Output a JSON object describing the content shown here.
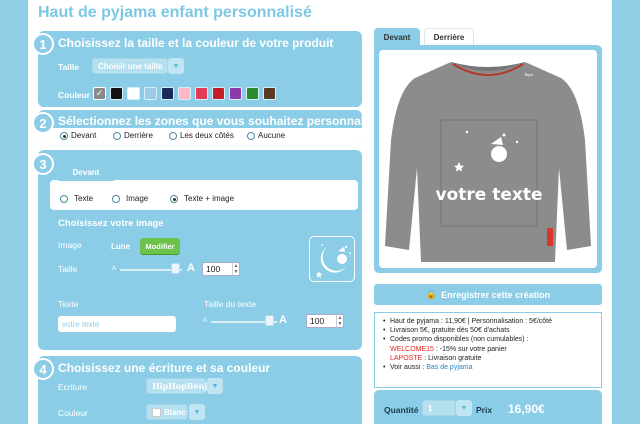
{
  "page": {
    "title": "Haut de pyjama enfant personnalisé"
  },
  "step1": {
    "number": "1",
    "title": "Choisissez la taille et la couleur de votre produit",
    "size_label": "Taille",
    "size_select": "Choisir une taille",
    "color_label": "Couleur",
    "swatches": [
      "#8a8a8a",
      "#111111",
      "#ffffff",
      "#9ccbe8",
      "#1a2a5a",
      "#ffb8c8",
      "#e33a5a",
      "#c41e2c",
      "#8a3aaa",
      "#2b8a2b",
      "#5a3a20"
    ]
  },
  "step2": {
    "number": "2",
    "title": "Sélectionnez les zones que vous souhaitez personnaliser",
    "options": [
      "Devant",
      "Derrière",
      "Les deux côtés",
      "Aucune"
    ],
    "selected": "Devant"
  },
  "step3": {
    "number": "3",
    "tab": "Devant",
    "options": [
      "Texte",
      "Image",
      "Texte + image"
    ],
    "selected": "Texte + image",
    "image_section_title": "Choisissez votre image",
    "image_label": "Image",
    "image_name": "Lune",
    "modify_button": "Modifier",
    "size_label": "Taille",
    "size_value": "100",
    "size_slider": 0.88,
    "text_label": "Texte",
    "text_placeholder": "votre texte",
    "text_size_label": "Taille du texte",
    "text_size_value": "100",
    "text_size_slider": 0.88,
    "slider_small": "A",
    "slider_big": "A"
  },
  "step4": {
    "number": "4",
    "title": "Choisissez une écriture et sa couleur",
    "font_label": "Ecriture",
    "font_value": "HipHopBenj",
    "color_label": "Couleur",
    "color_value": "Blanc"
  },
  "preview": {
    "tabs": [
      "Devant",
      "Derrière"
    ],
    "active_tab": "Devant",
    "design_text": "votre texte",
    "tag_text": "Bijzo"
  },
  "save_button": "Enregistrer cette création",
  "info": {
    "l1": "Haut de pyjama : 11,90€ | Personnalisation : 5€/côté",
    "l2": "Livraison 5€, gratuite dès 50€ d'achats",
    "l3": "Codes promo disponibles (non cumulables) :",
    "code1": "WELCOME15",
    "code1_desc": " : -15% sur votre panier",
    "code2": "LAPOSTE",
    "code2_desc": " : Livraison gratuite",
    "l6_prefix": "Voir aussi : ",
    "l6_link": "Bas de pyjama"
  },
  "order": {
    "qty_label": "Quantité",
    "qty_value": "1",
    "price_label": "Prix",
    "price": "16,90€"
  },
  "colors": {
    "accent": "#8bcde6",
    "title": "#7cc8e3",
    "green": "#6cc24a",
    "red": "#e0271f"
  }
}
